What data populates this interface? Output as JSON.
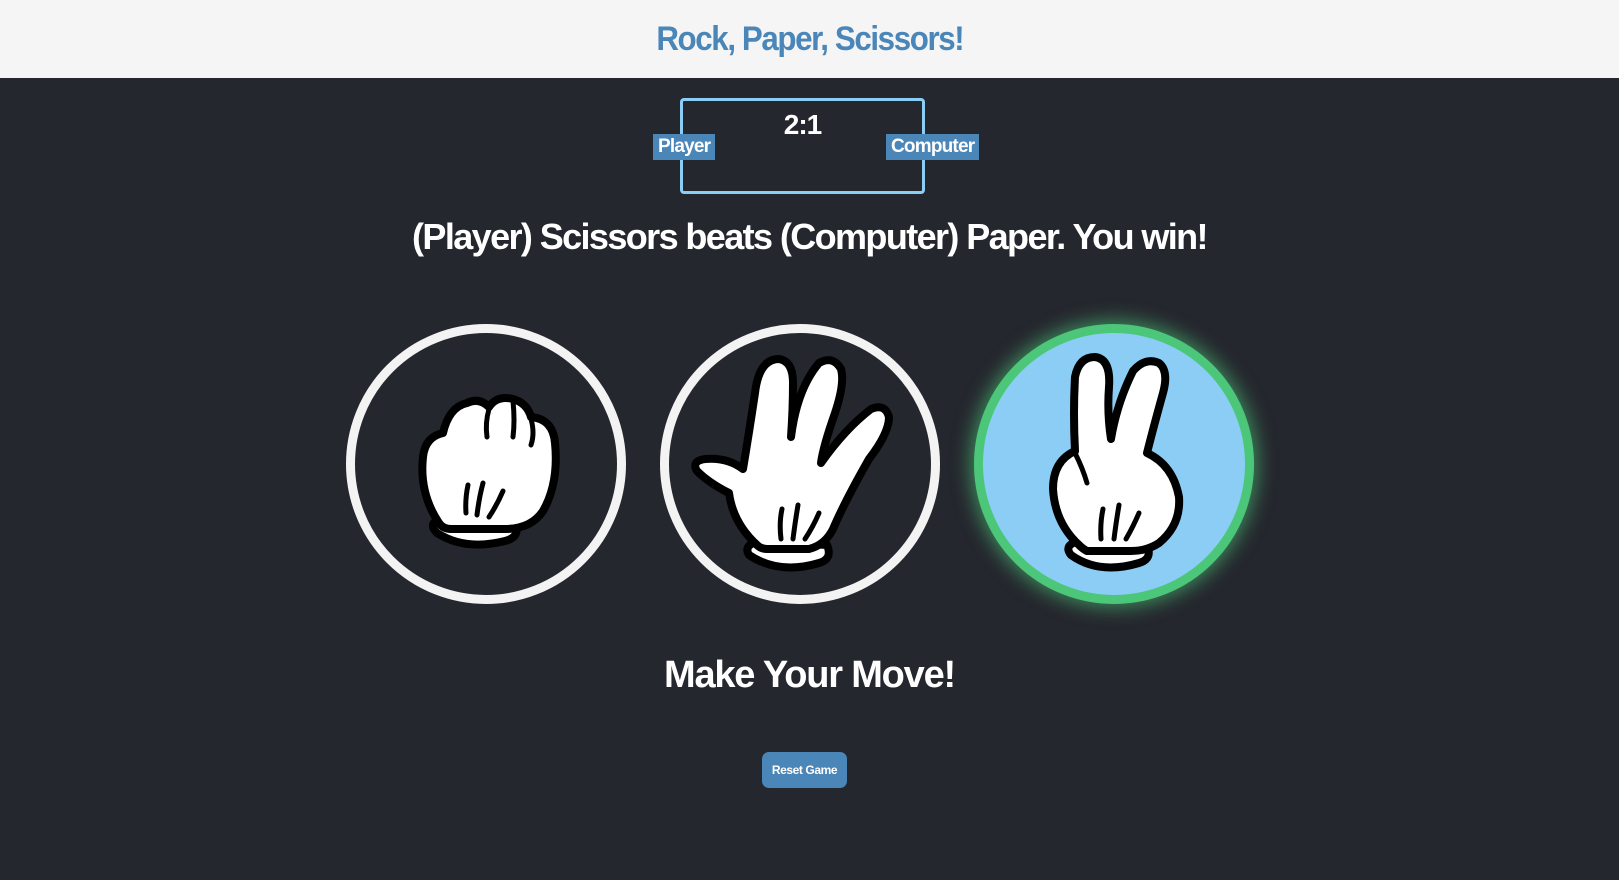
{
  "header": {
    "title": "Rock, Paper, Scissors!"
  },
  "scoreboard": {
    "score": "2:1",
    "player_label": "Player",
    "computer_label": "Computer"
  },
  "result": {
    "message": "(Player) Scissors beats (Computer) Paper. You win!"
  },
  "choices": [
    {
      "icon": "rock-hand-icon",
      "selected": false
    },
    {
      "icon": "paper-hand-icon",
      "selected": false
    },
    {
      "icon": "scissors-hand-icon",
      "selected": true
    }
  ],
  "prompt": "Make Your Move!",
  "controls": {
    "reset_label": "Reset Game"
  },
  "colors": {
    "background": "#25272e",
    "header_bg": "#f5f5f5",
    "accent_blue": "#4a86b8",
    "light_blue": "#8ccdf5",
    "win_green": "#4cc77a",
    "ring_white": "#f3f3f3"
  }
}
